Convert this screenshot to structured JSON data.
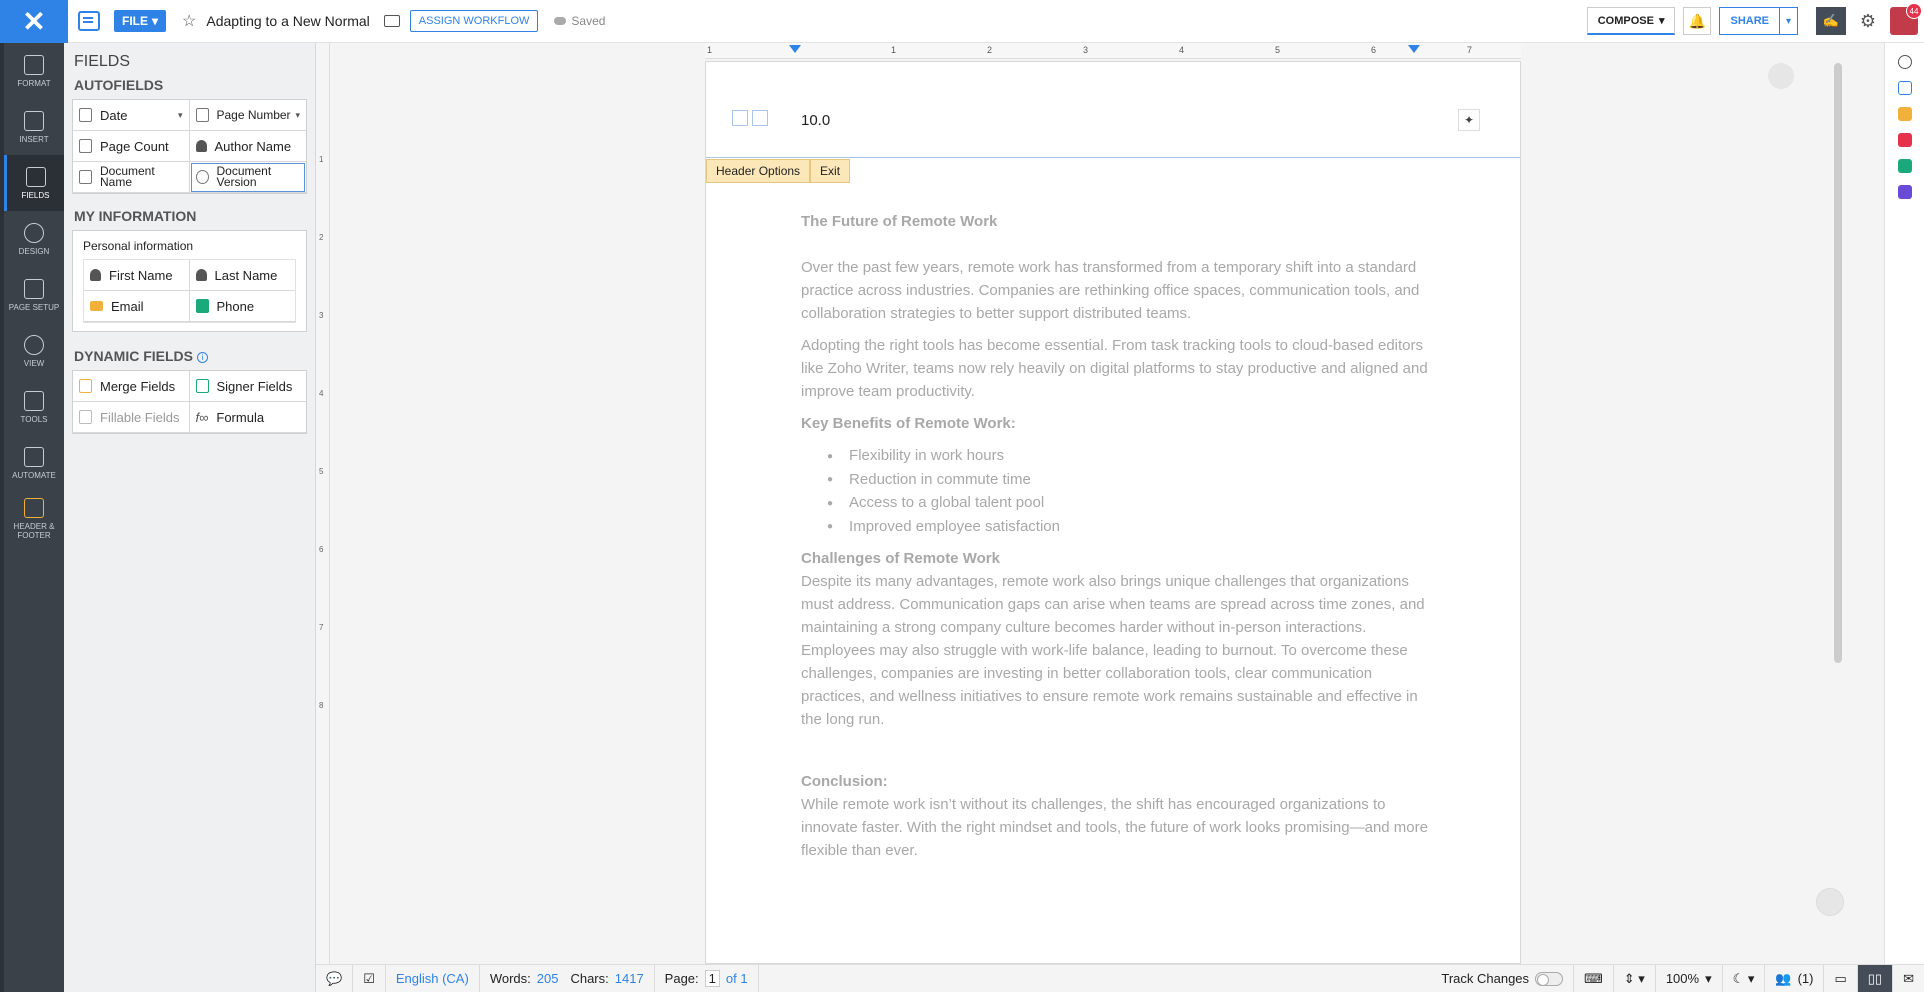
{
  "topbar": {
    "file_label": "FILE",
    "doc_title": "Adapting to a New Normal",
    "assign_workflow": "ASSIGN WORKFLOW",
    "saved": "Saved",
    "compose": "COMPOSE",
    "share": "SHARE",
    "notif_count": "44",
    "accent": "#2f83e6"
  },
  "leftnav": {
    "items": [
      {
        "label": "FORMAT"
      },
      {
        "label": "INSERT"
      },
      {
        "label": "FIELDS"
      },
      {
        "label": "DESIGN"
      },
      {
        "label": "PAGE SETUP"
      },
      {
        "label": "VIEW"
      },
      {
        "label": "TOOLS"
      },
      {
        "label": "AUTOMATE"
      },
      {
        "label": "HEADER & FOOTER"
      }
    ]
  },
  "panel": {
    "title": "FIELDS",
    "autofields_h": "AUTOFIELDS",
    "autofields": {
      "date": "Date",
      "page_number": "Page Number",
      "page_count": "Page Count",
      "author_name": "Author Name",
      "document_name": "Document Name",
      "document_version": "Document Version"
    },
    "myinfo_h": "MY INFORMATION",
    "personal_label": "Personal information",
    "personal": {
      "first_name": "First Name",
      "last_name": "Last Name",
      "email": "Email",
      "phone": "Phone"
    },
    "dynamic_h": "DYNAMIC FIELDS",
    "dynamic": {
      "merge": "Merge Fields",
      "signer": "Signer Fields",
      "fillable": "Fillable Fields",
      "formula": "Formula"
    }
  },
  "ruler": {
    "h": [
      "1",
      "1",
      "2",
      "3",
      "4",
      "5",
      "6",
      "7"
    ],
    "v": [
      "1",
      "2",
      "3",
      "4",
      "5",
      "6",
      "7",
      "8"
    ]
  },
  "document": {
    "header_value": "10.0",
    "header_options": "Header Options",
    "exit": "Exit",
    "heading1": "The Future of Remote Work",
    "para1": " Over the past few years, remote work has transformed from a temporary shift into a standard practice across industries. Companies are rethinking office spaces, communication tools, and collaboration strategies to better support distributed teams.",
    "para2": "Adopting the right tools has become essential. From task tracking tools to cloud-based editors like Zoho Writer, teams now rely heavily on digital platforms to stay productive and aligned and improve team productivity.",
    "heading2": "Key Benefits of Remote Work:",
    "benefits": [
      "Flexibility in work hours",
      "Reduction in commute time",
      "Access to a global talent pool",
      "Improved employee satisfaction"
    ],
    "heading3": "Challenges of Remote Work",
    "para3": " Despite its many advantages, remote work also brings unique challenges that organizations must address. Communication gaps can arise when teams are spread across time zones, and maintaining a strong company culture becomes harder without in-person interactions. Employees may also struggle with work-life balance, leading to burnout. To overcome these challenges, companies are investing in better collaboration tools, clear communication practices, and wellness initiatives to ensure remote work remains sustainable and effective in the long run.",
    "heading4": "Conclusion:",
    "para4": " While remote work isn’t without its challenges, the shift has encouraged organizations to innovate faster. With the right mindset and tools, the future of work looks promising—and more flexible than ever."
  },
  "status": {
    "language": "English (CA)",
    "words_label": "Words:",
    "words": "205",
    "chars_label": "Chars:",
    "chars": "1417",
    "page_label": "Page:",
    "page": "1",
    "page_of": "of 1",
    "track_changes": "Track Changes",
    "zoom": "100%",
    "collaborators": "(1)"
  }
}
